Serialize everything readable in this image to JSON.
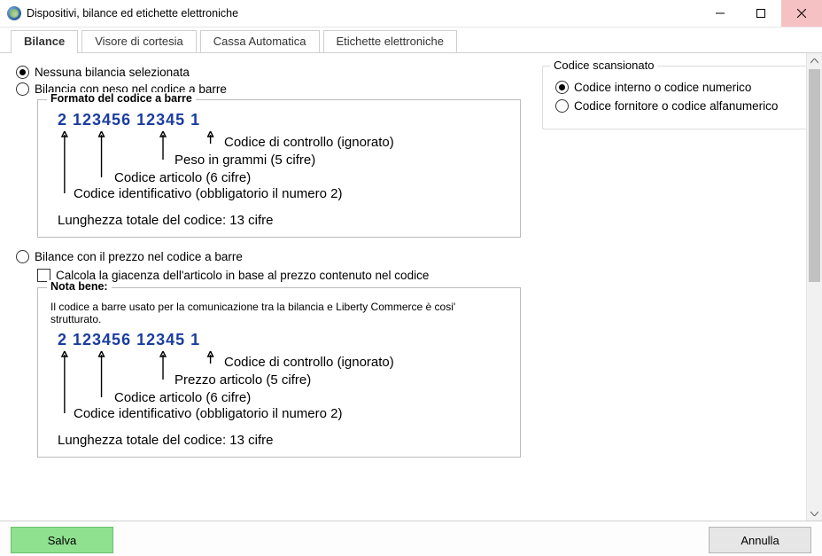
{
  "window": {
    "title": "Dispositivi, bilance ed etichette elettroniche"
  },
  "tabs": [
    "Bilance",
    "Visore di cortesia",
    "Cassa Automatica",
    "Etichette elettroniche"
  ],
  "left": {
    "opt_none": "Nessuna bilancia selezionata",
    "opt_weight": "Bilancia con peso nel codice a barre",
    "opt_price": "Bilance con il prezzo nel codice a barre",
    "price_calc_check": "Calcola la giacenza dell'articolo in base al prezzo contenuto nel codice",
    "box1": {
      "legend": "Formato del codice a barre",
      "digits": "2 123456 12345 1",
      "l_control": "Codice di controllo (ignorato)",
      "l_weight": "Peso in grammi (5 cifre)",
      "l_art": "Codice articolo (6 cifre)",
      "l_id": "Codice identificativo (obbligatorio il numero 2)",
      "l_len": "Lunghezza totale del codice: 13 cifre"
    },
    "box2": {
      "legend": "Nota bene:",
      "note": "Il codice a barre usato per la comunicazione tra la bilancia e Liberty Commerce è cosi' strutturato.",
      "digits": "2 123456 12345 1",
      "l_control": "Codice di controllo (ignorato)",
      "l_price": "Prezzo articolo (5 cifre)",
      "l_art": "Codice articolo (6 cifre)",
      "l_id": "Codice identificativo (obbligatorio il numero 2)",
      "l_len": "Lunghezza totale del codice: 13 cifre"
    }
  },
  "right": {
    "group": "Codice scansionato",
    "opt_internal": "Codice interno o codice numerico",
    "opt_vendor": "Codice fornitore o codice alfanumerico"
  },
  "footer": {
    "save": "Salva",
    "cancel": "Annulla"
  }
}
